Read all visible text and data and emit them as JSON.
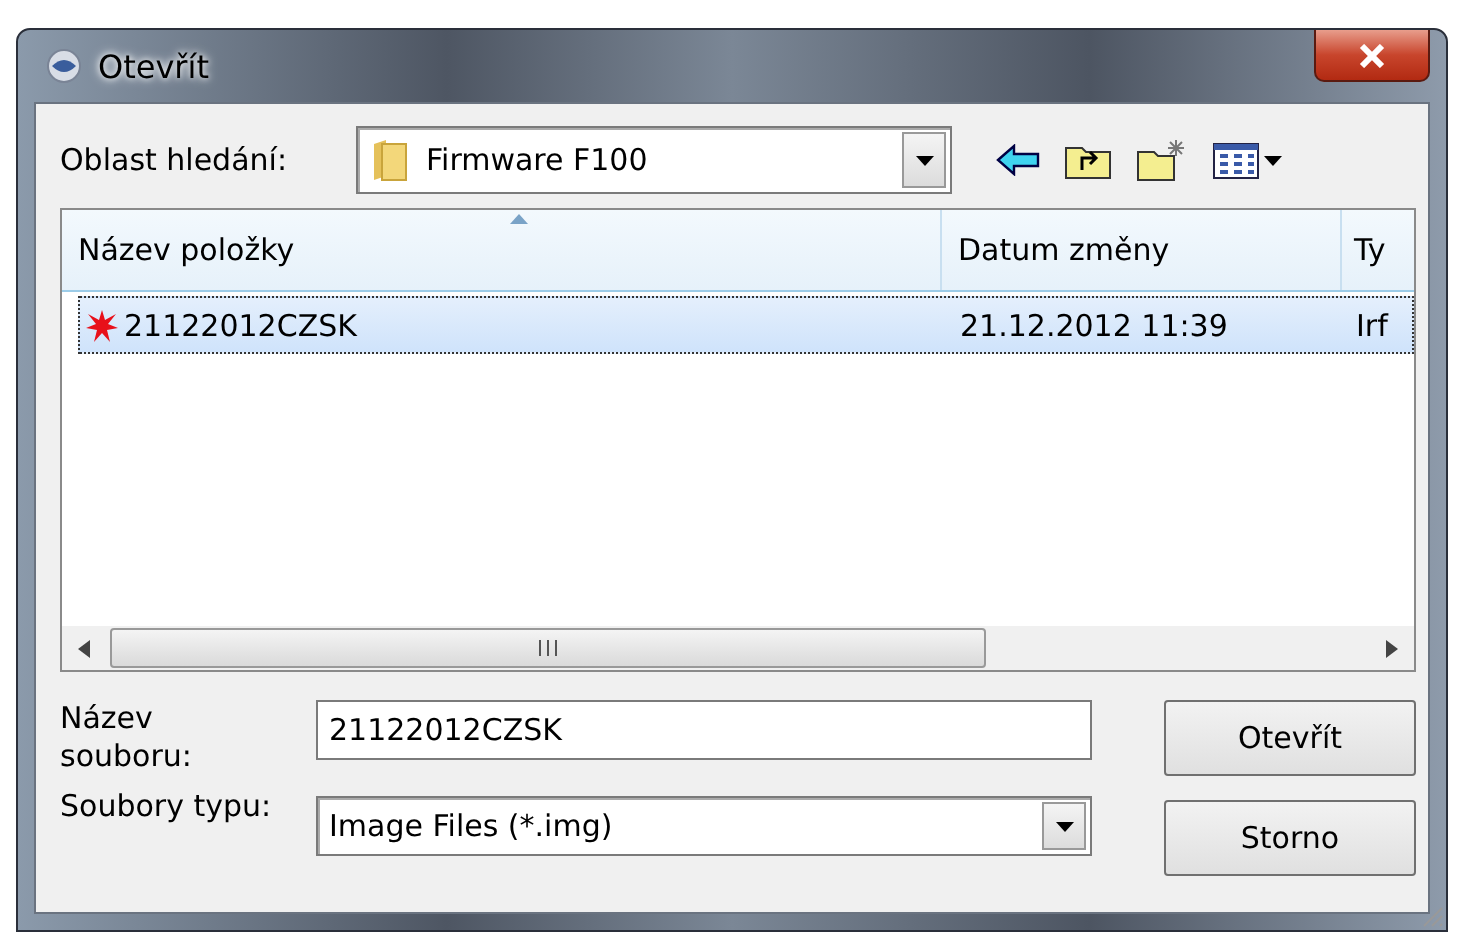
{
  "window": {
    "title": "Otevřít"
  },
  "look_in": {
    "label": "Oblast hledání:",
    "value": "Firmware F100"
  },
  "file_list": {
    "columns": [
      "Název položky",
      "Datum změny",
      "Ty"
    ],
    "rows": [
      {
        "name": "21122012CZSK",
        "date": "21.12.2012 11:39",
        "column_3": "Irf",
        "selected": true
      }
    ]
  },
  "file_name": {
    "label": "Název souboru:",
    "value": "21122012CZSK"
  },
  "file_type": {
    "label": "Soubory typu:",
    "value": "Image Files (*.img)"
  },
  "buttons": [
    "Otevřít",
    "Storno"
  ]
}
